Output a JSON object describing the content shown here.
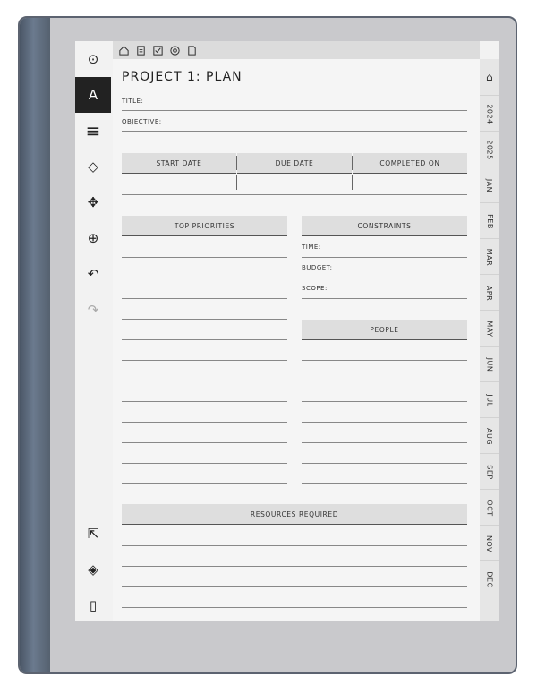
{
  "toolbar": {
    "tools": [
      {
        "name": "menu-circle-icon",
        "glyph": "⊙"
      },
      {
        "name": "pen-icon",
        "glyph": "A"
      },
      {
        "name": "stroke-icon",
        "glyph": "≡"
      },
      {
        "name": "eraser-icon",
        "glyph": "◇"
      },
      {
        "name": "move-icon",
        "glyph": "✥"
      },
      {
        "name": "zoom-icon",
        "glyph": "⊕"
      },
      {
        "name": "undo-icon",
        "glyph": "↶"
      },
      {
        "name": "redo-icon",
        "glyph": "↷"
      },
      {
        "name": "share-icon",
        "glyph": "⇱"
      },
      {
        "name": "layers-icon",
        "glyph": "◈"
      },
      {
        "name": "page-icon",
        "glyph": "▯"
      }
    ]
  },
  "topbar": {
    "icons": [
      "home-icon",
      "clipboard-icon",
      "check-icon",
      "target-icon",
      "document-icon"
    ]
  },
  "page": {
    "title": "PROJECT 1: PLAN",
    "title_label": "TITLE:",
    "objective_label": "OBJECTIVE:",
    "dates": {
      "start": "START DATE",
      "due": "DUE DATE",
      "completed": "COMPLETED ON"
    },
    "priorities": "TOP PRIORITIES",
    "constraints": {
      "header": "CONSTRAINTS",
      "time": "TIME:",
      "budget": "BUDGET:",
      "scope": "SCOPE:"
    },
    "people": "PEOPLE",
    "resources": "RESOURCES REQUIRED"
  },
  "tabs": [
    "⌂",
    "2024",
    "2025",
    "JAN",
    "FEB",
    "MAR",
    "APR",
    "MAY",
    "JUN",
    "JUL",
    "AUG",
    "SEP",
    "OCT",
    "NOV",
    "DEC"
  ]
}
